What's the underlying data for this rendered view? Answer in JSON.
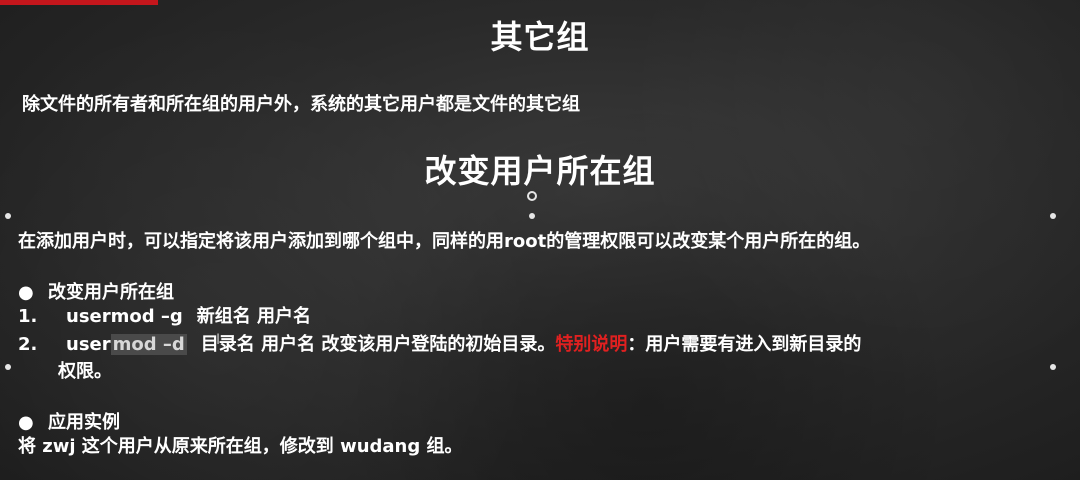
{
  "slide": {
    "heading1": "其它组",
    "desc1": "除文件的所有者和所在组的用户外，系统的其它用户都是文件的其它组",
    "heading2": "改变用户所在组",
    "desc2": "在添加用户时，可以指定将该用户添加到哪个组中，同样的用root的管理权限可以改变某个用户所在的组。",
    "bullet1": {
      "symbol": "●",
      "text": "改变用户所在组"
    },
    "item1": {
      "number": "1.",
      "command": "usermod   –g",
      "args": "新组名  用户名"
    },
    "item2": {
      "number": "2.",
      "command_pre": "user",
      "command_highlight": "mod   –d",
      "args": "目录名  用户名  改变该用户登陆的初始目录。",
      "special_label": "特别说明",
      "special_rest": "：用户需要有进入到新目录的",
      "continuation": "权限。"
    },
    "bullet2": {
      "symbol": "●",
      "text": "应用实例"
    },
    "example": "将 zwj 这个用户从原来所在组，修改到 wudang 组。"
  },
  "colors": {
    "background": "#2a2a2a",
    "text": "#ffffff",
    "special": "#e02020",
    "accent_bar": "#c4161c"
  }
}
